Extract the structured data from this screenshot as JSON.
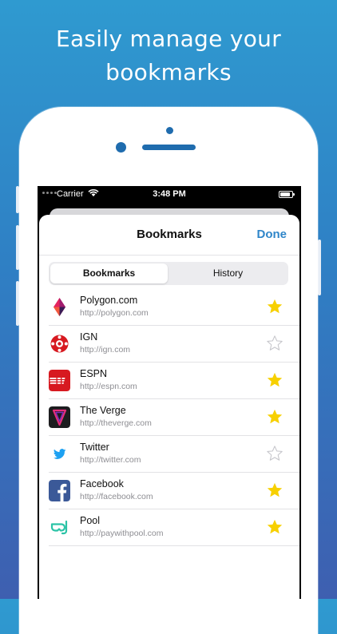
{
  "headline": {
    "line1": "Easily manage your",
    "line2": "bookmarks"
  },
  "status_bar": {
    "carrier": "Carrier",
    "time": "3:48 PM"
  },
  "nav": {
    "title": "Bookmarks",
    "done_label": "Done"
  },
  "tabs": [
    {
      "label": "Bookmarks",
      "selected": true
    },
    {
      "label": "History",
      "selected": false
    }
  ],
  "bookmarks": [
    {
      "name": "Polygon.com",
      "url": "http://polygon.com",
      "starred": true,
      "icon": "polygon-logo-icon"
    },
    {
      "name": "IGN",
      "url": "http://ign.com",
      "starred": false,
      "icon": "ign-logo-icon"
    },
    {
      "name": "ESPN",
      "url": "http://espn.com",
      "starred": true,
      "icon": "espn-logo-icon"
    },
    {
      "name": "The Verge",
      "url": "http://theverge.com",
      "starred": true,
      "icon": "verge-logo-icon"
    },
    {
      "name": "Twitter",
      "url": "http://twitter.com",
      "starred": false,
      "icon": "twitter-logo-icon"
    },
    {
      "name": "Facebook",
      "url": "http://facebook.com",
      "starred": true,
      "icon": "facebook-logo-icon"
    },
    {
      "name": "Pool",
      "url": "http://paywithpool.com",
      "starred": true,
      "icon": "pool-logo-icon"
    }
  ],
  "colors": {
    "accent": "#2f86c9",
    "star_filled": "#f7d000",
    "star_outline": "#c7c7cc",
    "background_top": "#2f9ad0",
    "background_bottom": "#3e5fb0"
  }
}
